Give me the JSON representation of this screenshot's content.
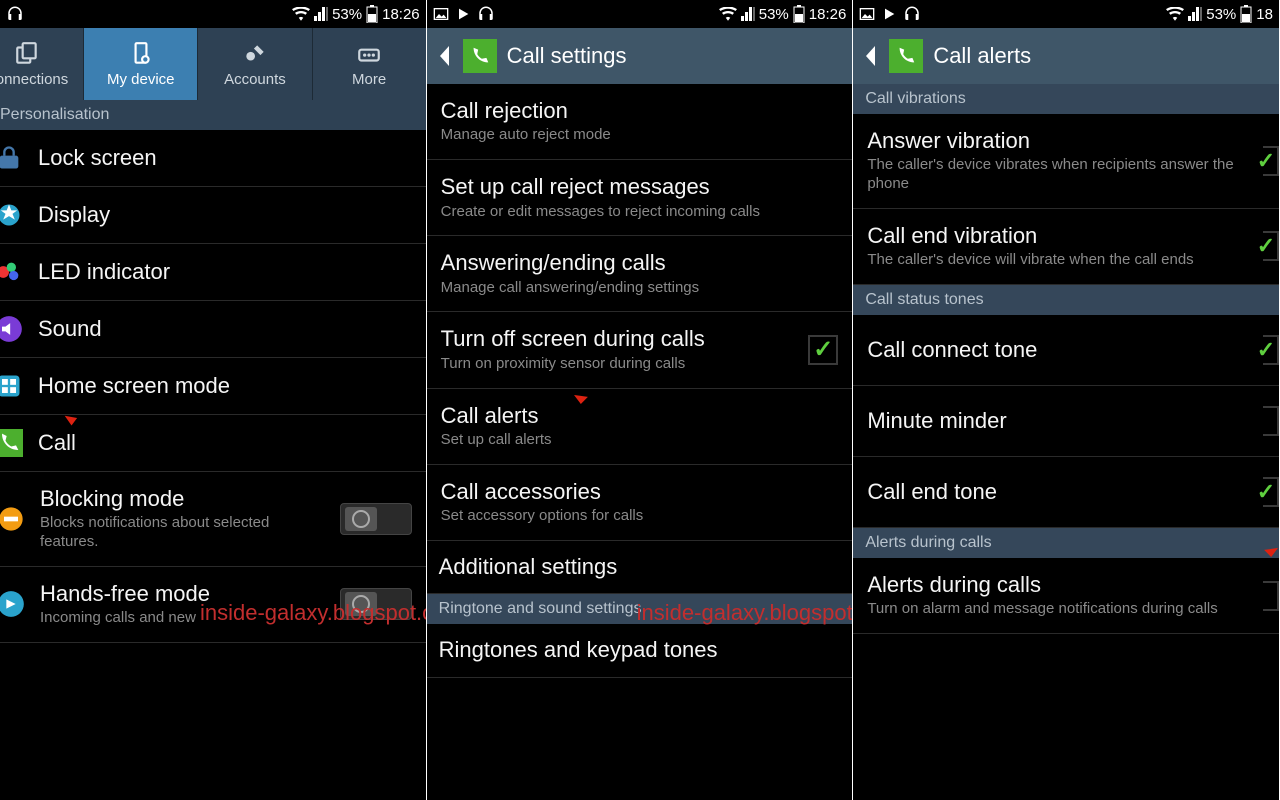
{
  "status": {
    "battery": "53%",
    "time": "18:26"
  },
  "panel1": {
    "tabs": {
      "connections": "Connections",
      "mydevice": "My device",
      "accounts": "Accounts",
      "more": "More"
    },
    "section": "Personalisation",
    "items": {
      "lock": "Lock screen",
      "display": "Display",
      "led": "LED indicator",
      "sound": "Sound",
      "home": "Home screen mode",
      "call": "Call",
      "blocking_title": "Blocking mode",
      "blocking_sub": "Blocks notifications about selected features.",
      "hands_title": "Hands-free mode",
      "hands_sub": "Incoming calls and new"
    }
  },
  "panel2": {
    "title": "Call settings",
    "items": {
      "rej_t": "Call rejection",
      "rej_s": "Manage auto reject mode",
      "msg_t": "Set up call reject messages",
      "msg_s": "Create or edit messages to reject incoming calls",
      "ans_t": "Answering/ending calls",
      "ans_s": "Manage call answering/ending settings",
      "off_t": "Turn off screen during calls",
      "off_s": "Turn on proximity sensor during calls",
      "alerts_t": "Call alerts",
      "alerts_s": "Set up call alerts",
      "acc_t": "Call accessories",
      "acc_s": "Set accessory options for calls",
      "add_t": "Additional settings",
      "ring_section": "Ringtone and sound settings",
      "ring_t": "Ringtones and keypad tones"
    }
  },
  "panel3": {
    "title": "Call alerts",
    "section1": "Call vibrations",
    "av_t": "Answer vibration",
    "av_s": "The caller's device vibrates when recipients answer the phone",
    "cev_t": "Call end vibration",
    "cev_s": "The caller's device will vibrate when the call ends",
    "section2": "Call status tones",
    "connect": "Call connect tone",
    "minute": "Minute minder",
    "endtone": "Call end tone",
    "section3": "Alerts during calls",
    "adc_t": "Alerts during calls",
    "adc_s": "Turn on alarm and message notifications during calls"
  },
  "watermark": "inside-galaxy.blogspot.com"
}
